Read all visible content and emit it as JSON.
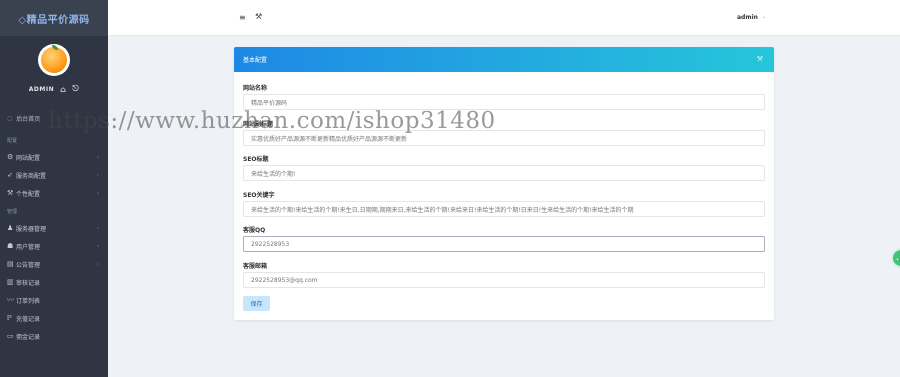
{
  "brand": {
    "title": "◇精品平价源码"
  },
  "user": {
    "name": "ADMIN",
    "home_icon": "home-icon",
    "logout_icon": "logout-icon"
  },
  "sidebar": {
    "home": {
      "label": "后台首页",
      "icon": "dashboard-icon"
    },
    "group1": {
      "title": "配置",
      "items": [
        {
          "label": "网站配置",
          "icon": "gear-icon"
        },
        {
          "label": "服务商配置",
          "icon": "send-icon"
        },
        {
          "label": "个性配置",
          "icon": "wrench-icon"
        }
      ]
    },
    "group2": {
      "title": "管理",
      "items": [
        {
          "label": "服务器管理",
          "icon": "server-icon",
          "arrow": true
        },
        {
          "label": "用户管理",
          "icon": "users-icon",
          "arrow": true
        },
        {
          "label": "公告管理",
          "icon": "notice-icon",
          "arrow": true
        },
        {
          "label": "审核记录",
          "icon": "bar-chart-icon",
          "arrow": false
        },
        {
          "label": "订单列表",
          "icon": "line-chart-icon",
          "arrow": false
        },
        {
          "label": "充值记录",
          "icon": "paypal-icon",
          "arrow": false
        },
        {
          "label": "佣金记录",
          "icon": "window-icon",
          "arrow": false
        }
      ]
    }
  },
  "topbar": {
    "menu_icon": "menu-icon",
    "wrench_icon": "wrench-icon",
    "user_label": "admin"
  },
  "card": {
    "title": "基本配置",
    "fields": [
      {
        "label": "网站名称",
        "value": "精品平价源码"
      },
      {
        "label": "网站副标题",
        "value": "实惠优质好产品源源不断更新精品优质好产品源源不断更新"
      },
      {
        "label": "SEO标题",
        "value": "来给生活的个期!"
      },
      {
        "label": "SEO关键字",
        "value": "来给生活的个期!来给生活的个期!来生日,日期期,期期来日,来给生活的个期!来给来日!来给生活的个期!日来日!生来给生活的个期!来给生活的个期"
      },
      {
        "label": "客服QQ",
        "value": "2922528953"
      },
      {
        "label": "客服邮箱",
        "value": "2922528953@qq.com"
      }
    ],
    "save_label": "保存"
  },
  "watermark": "https://www.huzhan.com/ishop31480",
  "colors": {
    "sidebar": "#2f3542",
    "header_start": "#1e88e5",
    "header_end": "#26c6da",
    "save_bg": "#c8e6fb"
  }
}
